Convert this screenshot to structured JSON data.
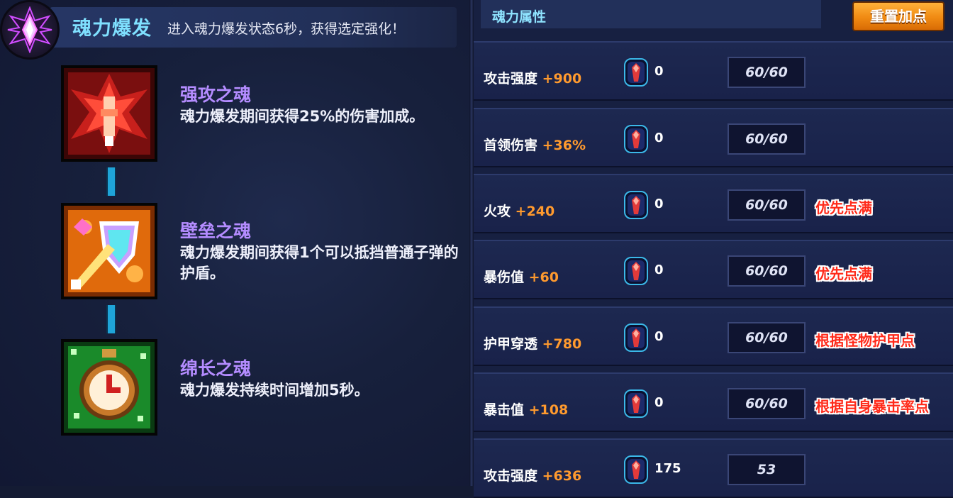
{
  "burst": {
    "title": "魂力爆发",
    "description": "进入魂力爆发状态6秒，获得选定强化！"
  },
  "skills": [
    {
      "name": "强攻之魂",
      "description": "魂力爆发期间获得25%的伤害加成。",
      "icon": "red-crossbow-emblem-icon"
    },
    {
      "name": "壁垒之魂",
      "description": "魂力爆发期间获得1个可以抵挡普通子弹的护盾。",
      "icon": "orange-shield-sword-icon"
    },
    {
      "name": "绵长之魂",
      "description": "魂力爆发持续时间增加5秒。",
      "icon": "green-stopwatch-icon"
    }
  ],
  "attributes": {
    "title": "魂力属性",
    "reset_label": "重置加点",
    "rows": [
      {
        "name": "攻击强度",
        "bonus": "+900",
        "points": "0",
        "level": "60/60",
        "note": ""
      },
      {
        "name": "首领伤害",
        "bonus": "+36%",
        "points": "0",
        "level": "60/60",
        "note": ""
      },
      {
        "name": "火攻",
        "bonus": "+240",
        "points": "0",
        "level": "60/60",
        "note": "优先点满"
      },
      {
        "name": "暴伤值",
        "bonus": "+60",
        "points": "0",
        "level": "60/60",
        "note": "优先点满"
      },
      {
        "name": "护甲穿透",
        "bonus": "+780",
        "points": "0",
        "level": "60/60",
        "note": "根据怪物护甲点"
      },
      {
        "name": "暴击值",
        "bonus": "+108",
        "points": "0",
        "level": "60/60",
        "note": "根据自身暴击率点"
      },
      {
        "name": "攻击强度",
        "bonus": "+636",
        "points": "175",
        "level": "53",
        "note": ""
      }
    ]
  },
  "colors": {
    "accent_cyan": "#7fe0ff",
    "skill_name": "#b48cff",
    "bonus_orange": "#ff9a2e",
    "note_red": "#ff2a1a",
    "button_orange": "#f08a12"
  }
}
